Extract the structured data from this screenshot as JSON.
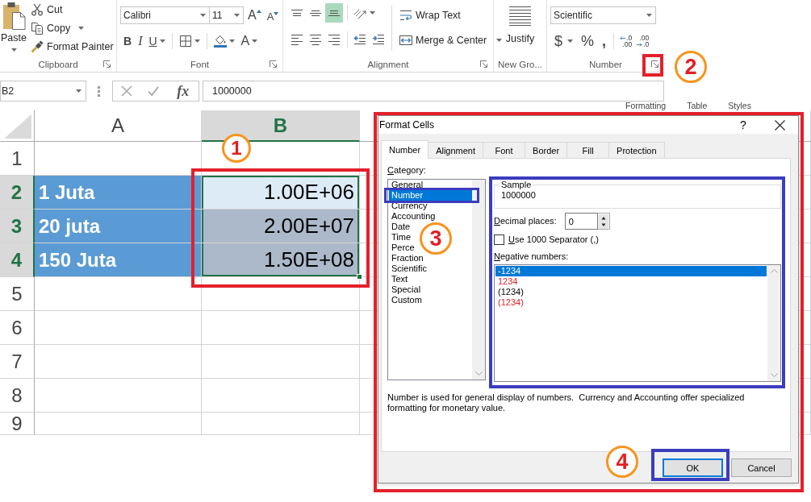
{
  "ribbon": {
    "clipboard": {
      "paste": {
        "label": "Paste",
        "dropdown": true
      },
      "commands": [
        {
          "kind": "cut",
          "label": "Cut",
          "dropdown": false
        },
        {
          "kind": "copy",
          "label": "Copy",
          "dropdown": true
        },
        {
          "kind": "painter",
          "label": "Format Painter",
          "dropdown": false
        }
      ],
      "label": "Clipboard",
      "launcher": true
    },
    "font": {
      "name": "Calibri",
      "size": "11",
      "size_buttons": [
        {
          "kind": "grow",
          "label": "A"
        },
        {
          "kind": "shrink",
          "label": "A"
        }
      ],
      "format_buttons": [
        {
          "kind": "bold",
          "label": "B",
          "dropdown": false
        },
        {
          "kind": "italic",
          "label": "I",
          "dropdown": false
        },
        {
          "kind": "underline",
          "label": "U",
          "dropdown": true
        },
        {
          "kind": "borders",
          "dropdown": true
        },
        {
          "kind": "fill",
          "dropdown": true
        },
        {
          "kind": "font-color",
          "label": "A",
          "dropdown": true
        }
      ],
      "label": "Font",
      "launcher": true
    },
    "alignment": {
      "vertical": [
        {
          "kind": "align-top",
          "selected": false
        },
        {
          "kind": "align-middle",
          "selected": false
        },
        {
          "kind": "align-bottom",
          "selected": true
        }
      ],
      "orientation": {
        "dropdown": true
      },
      "horizontal": [
        {
          "kind": "align-left",
          "selected": false
        },
        {
          "kind": "align-center",
          "selected": false
        },
        {
          "kind": "align-right",
          "selected": false
        }
      ],
      "indent": [
        {
          "kind": "indent-decrease"
        },
        {
          "kind": "indent-increase"
        }
      ],
      "wrap_text": "Wrap Text",
      "merge": {
        "label": "Merge & Center",
        "dropdown": true
      },
      "label": "Alignment",
      "launcher": true
    },
    "custom_group": {
      "justify": "Justify",
      "label": "New Gro...",
      "launcher": false
    },
    "number": {
      "format": "Scientific",
      "symbols": [
        {
          "kind": "currency",
          "label": "$",
          "dropdown": true
        },
        {
          "kind": "percent",
          "label": "%",
          "dropdown": false
        },
        {
          "kind": "comma",
          "label": ",",
          "dropdown": false
        }
      ],
      "decimals": [
        {
          "kind": "increase",
          "top": ".0",
          "bottom": ".00"
        },
        {
          "kind": "decrease",
          "top": ".00",
          "bottom": ".0"
        }
      ],
      "label": "Number",
      "launcher": true
    }
  },
  "formula_bar": {
    "name_box": "B2",
    "function_label": "fx",
    "value": "1000000"
  },
  "background_ribbon_labels": [
    "Formatting",
    "Table",
    "Styles"
  ],
  "sheet": {
    "columns": [
      {
        "label": "A",
        "selected": false
      },
      {
        "label": "B",
        "selected": true
      }
    ],
    "rows": [
      {
        "header": "1",
        "selected": false
      },
      {
        "header": "2",
        "selected": true,
        "cells": [
          {
            "kind": "label",
            "text": "1 Juta",
            "color": "#5b9bd5",
            "selected": false
          },
          {
            "kind": "number",
            "text": "1.00E+06",
            "color": "#ddebf7",
            "selected": true
          }
        ]
      },
      {
        "header": "3",
        "selected": true,
        "cells": [
          {
            "kind": "label",
            "text": "20 juta",
            "color": "#5b9bd5",
            "selected": false
          },
          {
            "kind": "number",
            "text": "2.00E+07",
            "color": "#acb9ca",
            "selected": true
          }
        ]
      },
      {
        "header": "4",
        "selected": true,
        "cells": [
          {
            "kind": "label",
            "text": "150 Juta",
            "color": "#5b9bd5",
            "selected": false
          },
          {
            "kind": "number",
            "text": "1.50E+08",
            "color": "#acb9ca",
            "selected": true
          }
        ]
      },
      {
        "header": "5",
        "selected": false
      },
      {
        "header": "6",
        "selected": false
      },
      {
        "header": "7",
        "selected": false
      },
      {
        "header": "8",
        "selected": false
      },
      {
        "header": "9",
        "selected": false
      }
    ]
  },
  "dialog": {
    "title": "Format Cells",
    "help": "?",
    "tabs": [
      {
        "label": "Number",
        "selected": true
      },
      {
        "label": "Alignment",
        "selected": false
      },
      {
        "label": "Font",
        "selected": false
      },
      {
        "label": "Border",
        "selected": false
      },
      {
        "label": "Fill",
        "selected": false
      },
      {
        "label": "Protection",
        "selected": false
      }
    ],
    "category": {
      "label": "Category:",
      "underline_first": true,
      "items": [
        {
          "label": "General",
          "selected": false
        },
        {
          "label": "Number",
          "selected": true
        },
        {
          "label": "Currency",
          "selected": false
        },
        {
          "label": "Accounting",
          "selected": false
        },
        {
          "label": "Date",
          "selected": false
        },
        {
          "label": "Time",
          "selected": false
        },
        {
          "label": "Perce",
          "selected": false
        },
        {
          "label": "Fraction",
          "selected": false
        },
        {
          "label": "Scientific",
          "selected": false
        },
        {
          "label": "Text",
          "selected": false
        },
        {
          "label": "Special",
          "selected": false
        },
        {
          "label": "Custom",
          "selected": false
        }
      ]
    },
    "sample": {
      "label": "Sample",
      "value": "1000000"
    },
    "decimal_places": {
      "label": "Decimal places:",
      "underline_first": true,
      "value": "0"
    },
    "thousands_separator": {
      "label": "Use 1000 Separator (,)",
      "underline_first": true,
      "checked": false
    },
    "negative_numbers": {
      "label": "Negative numbers:",
      "underline_first": true,
      "options": [
        {
          "text": "-1234",
          "selected": true
        },
        {
          "text": "1234",
          "selected": false,
          "color": "#d6252b"
        },
        {
          "text": "(1234)",
          "selected": false
        },
        {
          "text": "(1234)",
          "selected": false,
          "color": "#d6252b"
        }
      ]
    },
    "description": "Number is used for general display of numbers.  Currency and Accounting offer specialized formatting for monetary value.",
    "buttons": [
      {
        "label": "OK",
        "focused": true
      },
      {
        "label": "Cancel",
        "focused": false
      }
    ]
  },
  "annotation_frames": [
    {
      "color": "#e4202a"
    },
    {
      "color": "#e4202a"
    },
    {
      "color": "#e4202a"
    },
    {
      "color": "#3b3dbf"
    },
    {
      "color": "#3b3dbf"
    },
    {
      "color": "#3b3dbf"
    }
  ],
  "annotation_badges": [
    {
      "label": "1"
    },
    {
      "label": "2"
    },
    {
      "label": "3"
    },
    {
      "label": "4"
    }
  ]
}
